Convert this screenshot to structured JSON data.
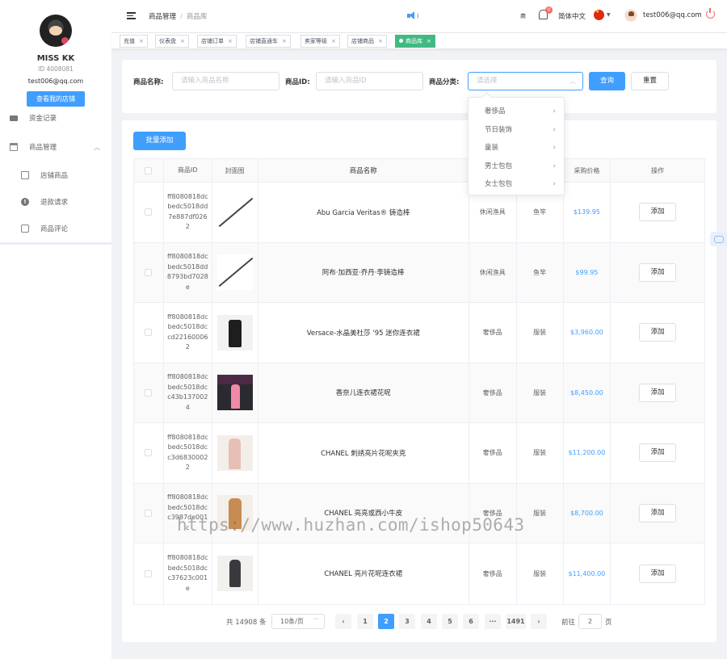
{
  "sidebar": {
    "user_name": "MISS KK",
    "user_id": "ID 4008081",
    "user_email": "test006@qq.com",
    "shop_button": "查看我的店铺",
    "menu": [
      {
        "label": "资金记录",
        "icon": "folder-icon"
      },
      {
        "label": "商品管理",
        "icon": "shop-icon",
        "expanded": true
      },
      {
        "label": "店铺商品",
        "icon": "bag-icon"
      },
      {
        "label": "退款请求",
        "icon": "warning-icon"
      },
      {
        "label": "商品评论",
        "icon": "chat-icon"
      }
    ]
  },
  "header": {
    "breadcrumb": [
      "商品管理",
      "商品库"
    ],
    "small_text": "商",
    "bell_badge": "0",
    "language": "简体中文",
    "email": "test006@qq.com"
  },
  "tags": [
    {
      "label": "充值",
      "active": false
    },
    {
      "label": "仪表盘",
      "active": false
    },
    {
      "label": "店铺订单",
      "active": false
    },
    {
      "label": "店铺直通车",
      "active": false
    },
    {
      "label": "卖家等级",
      "active": false
    },
    {
      "label": "店铺商品",
      "active": false
    },
    {
      "label": "商品库",
      "active": true
    }
  ],
  "search": {
    "name_label": "商品名称:",
    "name_placeholder": "请输入商品名称",
    "id_label": "商品ID:",
    "id_placeholder": "请输入商品ID",
    "category_label": "商品分类:",
    "category_placeholder": "请选择",
    "query_button": "查询",
    "reset_button": "重置"
  },
  "dropdown": [
    "奢侈品",
    "节日装饰",
    "童装",
    "男士包包",
    "女士包包"
  ],
  "table": {
    "batch_button": "批量添加",
    "columns": [
      "",
      "商品ID",
      "封面图",
      "商品名称",
      "",
      "",
      "采购价格",
      "操作"
    ],
    "rows": [
      {
        "id": "ff8080818dcbedc5018dd7e887df0262",
        "name": "Abu Garcia Veritas® 铸造棒",
        "category": "休闲渔具",
        "sub": "鱼竿",
        "price": "$139.95",
        "action": "添加",
        "thumb": "rod"
      },
      {
        "id": "ff8080818dcbedc5018dd8793bd7028e",
        "name": "阿布·加西亚·乔丹·李铸造棒",
        "category": "休闲渔具",
        "sub": "鱼竿",
        "price": "$99.95",
        "action": "添加",
        "thumb": "rod"
      },
      {
        "id": "ff8080818dcbedc5018dccd221600062",
        "name": "Versace-水晶美杜莎 '95 迷你连衣裙",
        "category": "奢侈品",
        "sub": "服装",
        "price": "$3,960.00",
        "action": "添加",
        "thumb": "dress1"
      },
      {
        "id": "ff8080818dcbedc5018dcc43b1370024",
        "name": "香奈儿连衣裙花呢",
        "category": "奢侈品",
        "sub": "服装",
        "price": "$8,450.00",
        "action": "添加",
        "thumb": "runway"
      },
      {
        "id": "ff8080818dcbedc5018dcc3d68300022",
        "name": "CHANEL 刺绣亮片花呢夹克",
        "category": "奢侈品",
        "sub": "服装",
        "price": "$11,200.00",
        "action": "添加",
        "thumb": "suit"
      },
      {
        "id": "ff8080818dcbedc5018dcc3987de001c",
        "name": "CHANEL 亮亮或西小牛皮",
        "category": "奢侈品",
        "sub": "服装",
        "price": "$8,700.00",
        "action": "添加",
        "thumb": "jacket"
      },
      {
        "id": "ff8080818dcbedc5018dcc37623c001e",
        "name": "CHANEL 亮片花呢连衣裙",
        "category": "奢侈品",
        "sub": "服装",
        "price": "$11,400.00",
        "action": "添加",
        "thumb": "tweed"
      }
    ]
  },
  "pagination": {
    "total": "共 14908 条",
    "page_size": "10条/页",
    "prev": "‹",
    "pages": [
      "1",
      "2",
      "3",
      "4",
      "5",
      "6",
      "···",
      "1491"
    ],
    "current": "2",
    "next": "›",
    "goto_label": "前往",
    "goto_value": "2",
    "page_suffix": "页"
  },
  "watermark": "https://www.huzhan.com/ishop50643",
  "colors": {
    "primary": "#409eff",
    "tag_active": "#42b983",
    "danger": "#f56c6c"
  }
}
